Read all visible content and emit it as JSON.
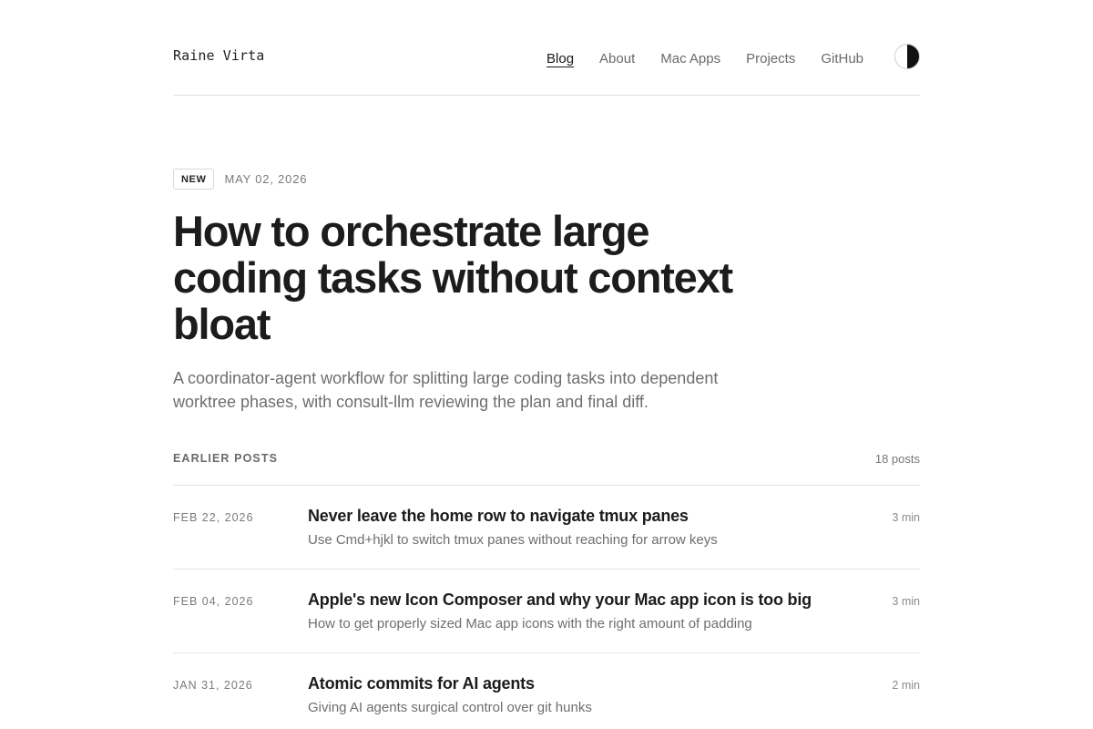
{
  "header": {
    "brand": "Raine Virta",
    "nav": [
      {
        "label": "Blog",
        "active": true
      },
      {
        "label": "About",
        "active": false
      },
      {
        "label": "Mac Apps",
        "active": false
      },
      {
        "label": "Projects",
        "active": false
      },
      {
        "label": "GitHub",
        "active": false
      }
    ],
    "theme_toggle_icon": "half-circle-contrast-icon"
  },
  "featured": {
    "badge": "NEW",
    "date": "MAY 02, 2026",
    "title": "How to orchestrate large coding tasks without context bloat",
    "description": "A coordinator-agent workflow for splitting large coding tasks into dependent worktree phases, with consult-llm reviewing the plan and final diff."
  },
  "earlier": {
    "label": "EARLIER POSTS",
    "count": "18 posts",
    "posts": [
      {
        "date": "FEB 22, 2026",
        "title": "Never leave the home row to navigate tmux panes",
        "subtitle": "Use Cmd+hjkl to switch tmux panes without reaching for arrow keys",
        "read_time": "3 min"
      },
      {
        "date": "FEB 04, 2026",
        "title": "Apple's new Icon Composer and why your Mac app icon is too big",
        "subtitle": "How to get properly sized Mac app icons with the right amount of padding",
        "read_time": "3 min"
      },
      {
        "date": "JAN 31, 2026",
        "title": "Atomic commits for AI agents",
        "subtitle": "Giving AI agents surgical control over git hunks",
        "read_time": "2 min"
      }
    ]
  },
  "colors": {
    "text": "#1c1c1c",
    "muted": "#6e6e6e",
    "divider": "#e3e3e3",
    "background": "#ffffff"
  }
}
